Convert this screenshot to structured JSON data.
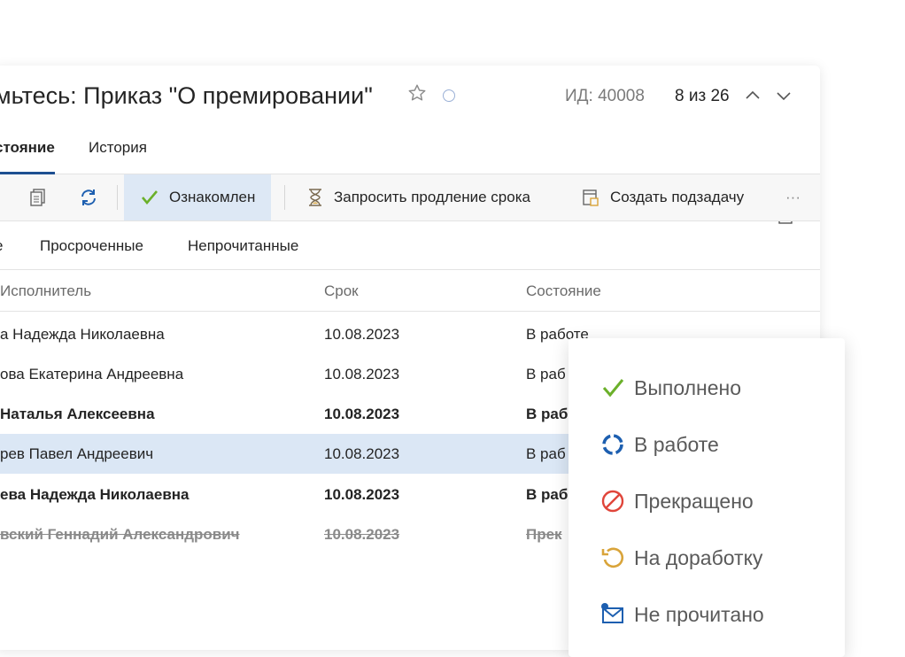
{
  "header": {
    "title": "мьтесь: Приказ \"О премировании\"",
    "id_label": "ИД: 40008",
    "counter": "8 из 26"
  },
  "tabs": [
    {
      "label": "стояние",
      "active": true
    },
    {
      "label": "История",
      "active": false
    }
  ],
  "toolbar": {
    "acknowledged": "Ознакомлен",
    "request_extension": "Запросить продление срока",
    "create_subtask": "Создать подзадачу",
    "more": "···"
  },
  "filters": [
    "е",
    "Просроченные",
    "Непрочитанные"
  ],
  "table": {
    "headers": [
      "Исполнитель",
      "Срок",
      "Состояние"
    ],
    "rows": [
      {
        "executor": "а Надежда Николаевна",
        "due": "10.08.2023",
        "status": "В работе",
        "style": "normal"
      },
      {
        "executor": "ова Екатерина Андреевна",
        "due": "10.08.2023",
        "status": "В раб",
        "style": "normal"
      },
      {
        "executor": "Наталья Алексеевна",
        "due": "10.08.2023",
        "status": "В раб",
        "style": "bold"
      },
      {
        "executor": "рев Павел Андреевич",
        "due": "10.08.2023",
        "status": "В раб",
        "style": "selected"
      },
      {
        "executor": "ева Надежда Николаевна",
        "due": "10.08.2023",
        "status": "В раб",
        "style": "bold"
      },
      {
        "executor": "вский Геннадий Александрович",
        "due": "10.08.2023",
        "status": "Прек",
        "style": "strike"
      }
    ]
  },
  "status_menu": {
    "options": [
      {
        "label": "Выполнено",
        "icon": "check-icon",
        "color": "#6bb02a"
      },
      {
        "label": "В работе",
        "icon": "in-progress-icon",
        "color": "#1d5fb0"
      },
      {
        "label": "Прекращено",
        "icon": "stop-icon",
        "color": "#e0453a"
      },
      {
        "label": "На доработку",
        "icon": "rework-icon",
        "color": "#d9a43a"
      },
      {
        "label": "Не прочитано",
        "icon": "unread-mail-icon",
        "color": "#1d5fb0"
      }
    ]
  },
  "colors": {
    "accent": "#1d4f91",
    "selected_row": "#dbe7f5",
    "active_button": "#dde8f5"
  }
}
